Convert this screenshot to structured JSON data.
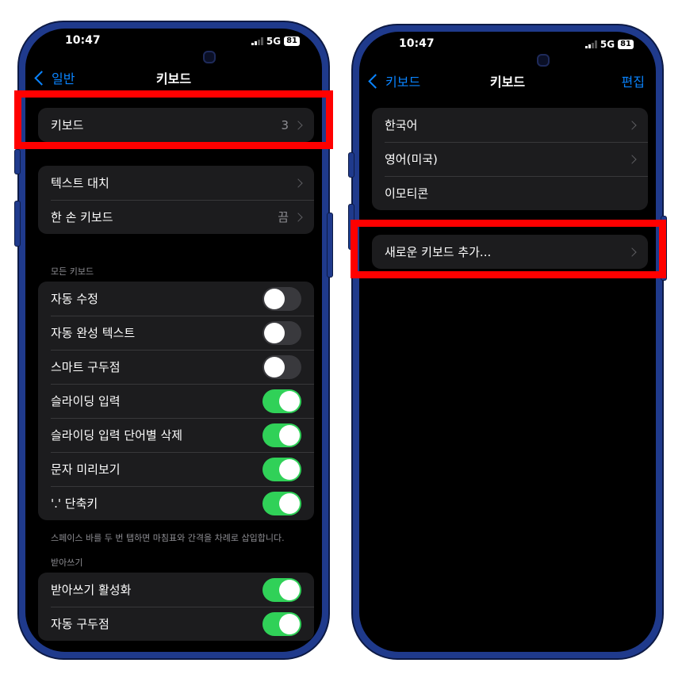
{
  "left": {
    "status": {
      "time": "10:47",
      "network": "5G",
      "battery": "81"
    },
    "nav": {
      "back": "일반",
      "title": "키보드"
    },
    "keyboards_row": {
      "label": "키보드",
      "value": "3"
    },
    "group2": [
      {
        "label": "텍스트 대치",
        "value": ""
      },
      {
        "label": "한 손 키보드",
        "value": "끔"
      }
    ],
    "all_keyboards_label": "모든 키보드",
    "toggles": [
      {
        "label": "자동 수정",
        "on": false
      },
      {
        "label": "자동 완성 텍스트",
        "on": false
      },
      {
        "label": "스마트 구두점",
        "on": false
      },
      {
        "label": "슬라이딩 입력",
        "on": true
      },
      {
        "label": "슬라이딩 입력 단어별 삭제",
        "on": true
      },
      {
        "label": "문자 미리보기",
        "on": true
      },
      {
        "label": "'.' 단축키",
        "on": true
      }
    ],
    "footnote": "스페이스 바를 두 번 탭하면 마침표와 간격을 차례로 삽입합니다.",
    "dictation_label": "받아쓰기",
    "dictation_toggles": [
      {
        "label": "받아쓰기 활성화",
        "on": true
      },
      {
        "label": "자동 구두점",
        "on": true
      }
    ]
  },
  "right": {
    "status": {
      "time": "10:47",
      "network": "5G",
      "battery": "81"
    },
    "nav": {
      "back": "키보드",
      "title": "키보드",
      "edit": "편집"
    },
    "keyboards": [
      {
        "label": "한국어",
        "chevron": true
      },
      {
        "label": "영어(미국)",
        "chevron": true
      },
      {
        "label": "이모티콘",
        "chevron": false
      }
    ],
    "add_keyboard": "새로운 키보드 추가..."
  },
  "colors": {
    "accent": "#0a84ff",
    "toggle_on": "#30d158",
    "highlight": "#ff0000",
    "frame": "#1f3a8c"
  }
}
